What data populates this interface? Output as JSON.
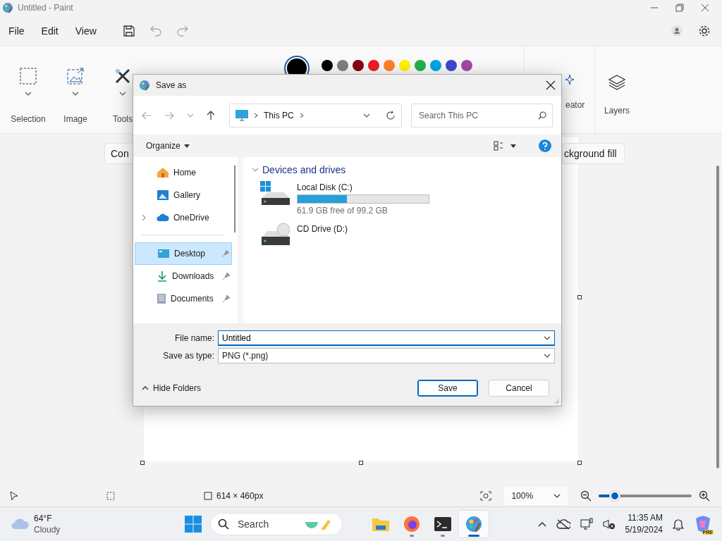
{
  "window": {
    "title": "Untitled - Paint"
  },
  "menu": [
    {
      "label": "File"
    },
    {
      "label": "Edit"
    },
    {
      "label": "View"
    }
  ],
  "quick_actions": [
    {
      "kind": "save",
      "disabled": false
    },
    {
      "kind": "undo",
      "disabled": true
    },
    {
      "kind": "redo",
      "disabled": true
    }
  ],
  "ribbon": {
    "groups": [
      {
        "kind": "selection",
        "label": "Selection"
      },
      {
        "kind": "image",
        "label": "Image"
      },
      {
        "kind": "tools",
        "label": "Tools"
      }
    ],
    "current_color": {
      "color": "#000000"
    },
    "palette": [
      {
        "color": "#000000"
      },
      {
        "color": "#7f7f7f"
      },
      {
        "color": "#880015"
      },
      {
        "color": "#ed1c24"
      },
      {
        "color": "#ff7f27"
      },
      {
        "color": "#fff200"
      },
      {
        "color": "#22b14c"
      },
      {
        "color": "#00a2e8"
      },
      {
        "color": "#3f48cc"
      },
      {
        "color": "#a349a4"
      }
    ],
    "right_groups": [
      {
        "kind": "creator",
        "label": "eator"
      },
      {
        "kind": "layers",
        "label": "Layers"
      }
    ]
  },
  "floating_toolbar": {
    "left_button": "Con",
    "right_button": "ckground fill"
  },
  "status_bar": {
    "canvas_size": "614 × 460px",
    "zoom": "100%",
    "zoom_slider": {
      "level": 0.17
    }
  },
  "taskbar": {
    "weather": {
      "temperature": "64°F",
      "condition": "Cloudy"
    },
    "search": {
      "placeholder": "Search"
    },
    "apps": [
      {
        "kind": "explorer",
        "running": false,
        "active": false
      },
      {
        "kind": "firefox",
        "running": true,
        "active": false
      },
      {
        "kind": "terminal",
        "running": true,
        "active": false
      },
      {
        "kind": "paint",
        "running": true,
        "active": true
      }
    ],
    "clock": {
      "time": "11:35 AM",
      "date": "5/19/2024"
    },
    "copilot_badge": "PRE"
  },
  "dialog": {
    "title": "Save as",
    "address": "This PC",
    "search": {
      "placeholder": "Search This PC"
    },
    "organize": "Organize",
    "nav_groups": [
      {
        "items": [
          {
            "kind": "home",
            "label": "Home",
            "expandable": false,
            "pinned": false,
            "selected": false
          },
          {
            "kind": "gallery",
            "label": "Gallery",
            "expandable": false,
            "pinned": false,
            "selected": false
          },
          {
            "kind": "cloud",
            "label": "OneDrive",
            "expandable": true,
            "pinned": false,
            "selected": false
          }
        ]
      },
      {
        "items": [
          {
            "kind": "desktop",
            "label": "Desktop",
            "expandable": false,
            "pinned": true,
            "selected": true
          },
          {
            "kind": "downloads",
            "label": "Downloads",
            "expandable": false,
            "pinned": true,
            "selected": false
          },
          {
            "kind": "documents",
            "label": "Documents",
            "expandable": false,
            "pinned": true,
            "selected": false
          }
        ]
      }
    ],
    "section": "Devices and drives",
    "drives": [
      {
        "kind": "disk",
        "name": "Local Disk (C:)",
        "level": 0.376,
        "detail": "61.9 GB free of 99.2 GB"
      },
      {
        "kind": "cd",
        "name": "CD Drive (D:)"
      }
    ],
    "file_name": {
      "label": "File name:",
      "value": "Untitled"
    },
    "save_type": {
      "label": "Save as type:",
      "value": "PNG (*.png)"
    },
    "hide_folders": "Hide Folders",
    "buttons": [
      {
        "label": "Save",
        "default": true
      },
      {
        "label": "Cancel",
        "default": false
      }
    ]
  }
}
